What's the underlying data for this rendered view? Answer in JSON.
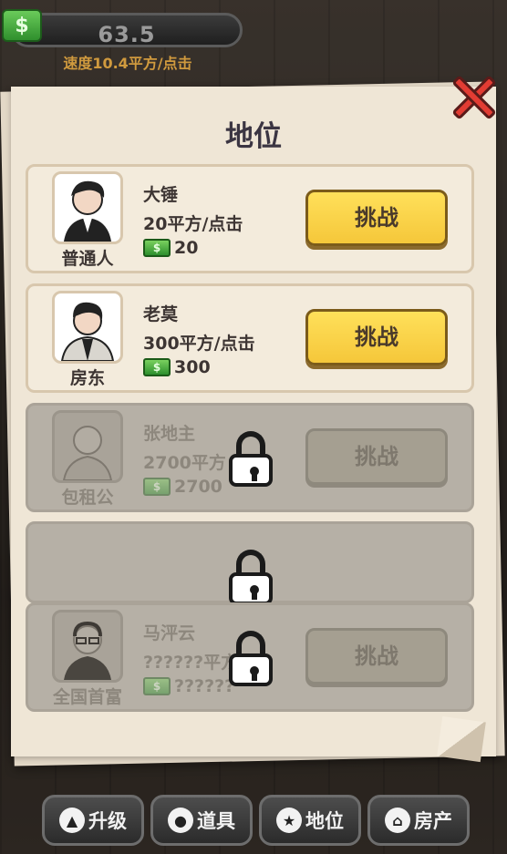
{
  "hud": {
    "money": "63.5",
    "speed": "速度10.4平方/点击",
    "money_icon": "$"
  },
  "panel": {
    "title": "地位"
  },
  "cards": [
    {
      "rank": "普通人",
      "name": "大锤",
      "rate": "20平方/点击",
      "cost": "20",
      "button": "挑战",
      "locked": false
    },
    {
      "rank": "房东",
      "name": "老莫",
      "rate": "300平方/点击",
      "cost": "300",
      "button": "挑战",
      "locked": false
    },
    {
      "rank": "包租公",
      "name": "张地主",
      "rate": "2700平方",
      "cost": "2700",
      "button": "挑战",
      "locked": true
    },
    {
      "rank": "",
      "name": "",
      "rate": "",
      "cost": "",
      "button": "",
      "locked": true
    },
    {
      "rank": "全国首富",
      "name": "马泙云",
      "rate": "??????平方",
      "cost": "??????",
      "button": "挑战",
      "locked": true
    }
  ],
  "tabs": [
    {
      "label": "升级",
      "icon": "upgrade-icon"
    },
    {
      "label": "道具",
      "icon": "piggy-bank-icon"
    },
    {
      "label": "地位",
      "icon": "medal-icon"
    },
    {
      "label": "房产",
      "icon": "house-icon"
    }
  ],
  "colors": {
    "accent": "#f5c73a",
    "close": "#e23c33",
    "money": "#2d8f2d"
  }
}
